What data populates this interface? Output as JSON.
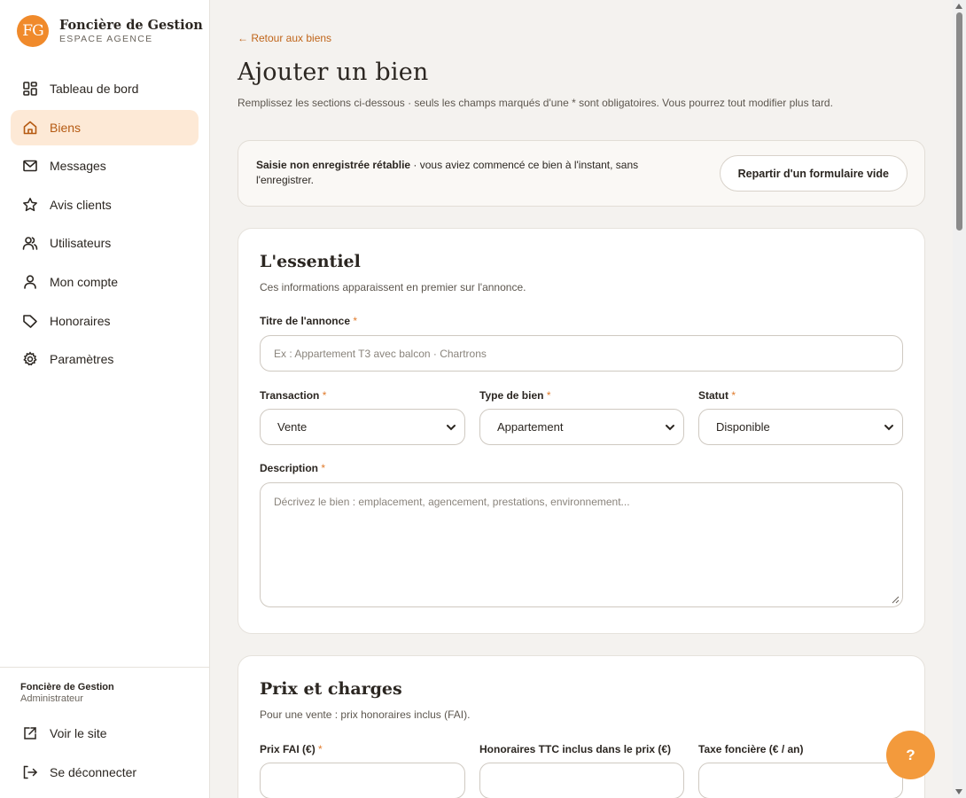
{
  "brand": {
    "logo": "FG",
    "name": "Foncière de Gestion",
    "subtitle": "ESPACE AGENCE"
  },
  "sidebar": {
    "items": [
      {
        "label": "Tableau de bord",
        "icon": "dashboard-icon"
      },
      {
        "label": "Biens",
        "icon": "home-icon",
        "active": true
      },
      {
        "label": "Messages",
        "icon": "mail-icon"
      },
      {
        "label": "Avis clients",
        "icon": "star-icon"
      },
      {
        "label": "Utilisateurs",
        "icon": "users-icon"
      },
      {
        "label": "Mon compte",
        "icon": "user-icon"
      },
      {
        "label": "Honoraires",
        "icon": "tag-icon"
      },
      {
        "label": "Paramètres",
        "icon": "gear-icon"
      }
    ],
    "footer": {
      "org_name": "Foncière de Gestion",
      "org_role": "Administrateur",
      "view_site": "Voir le site",
      "logout": "Se déconnecter"
    }
  },
  "page": {
    "back_link": "← Retour aux biens",
    "title": "Ajouter un bien",
    "subtitle": "Remplissez les sections ci-dessous · seuls les champs marqués d'une * sont obligatoires. Vous pourrez tout modifier plus tard."
  },
  "notice": {
    "bold": "Saisie non enregistrée rétablie",
    "text": " · vous aviez commencé ce bien à l'instant, sans l'enregistrer.",
    "button": "Repartir d'un formulaire vide"
  },
  "essentials": {
    "title": "L'essentiel",
    "subtitle": "Ces informations apparaissent en premier sur l'annonce.",
    "listing_title_label": "Titre de l'annonce",
    "listing_title_placeholder": "Ex : Appartement T3 avec balcon · Chartrons",
    "transaction_label": "Transaction",
    "transaction_value": "Vente",
    "type_label": "Type de bien",
    "type_value": "Appartement",
    "status_label": "Statut",
    "status_value": "Disponible",
    "description_label": "Description",
    "description_placeholder": "Décrivez le bien : emplacement, agencement, prestations, environnement..."
  },
  "pricing": {
    "title": "Prix et charges",
    "subtitle": "Pour une vente : prix honoraires inclus (FAI).",
    "price_label": "Prix FAI (€)",
    "fees_label": "Honoraires TTC inclus dans le prix (€)",
    "tax_label": "Taxe foncière (€ / an)"
  },
  "required_mark": "*",
  "help_button": "?",
  "colors": {
    "accent": "#f08a2b",
    "active_bg": "#fde9d6",
    "active_text": "#b55a12"
  }
}
